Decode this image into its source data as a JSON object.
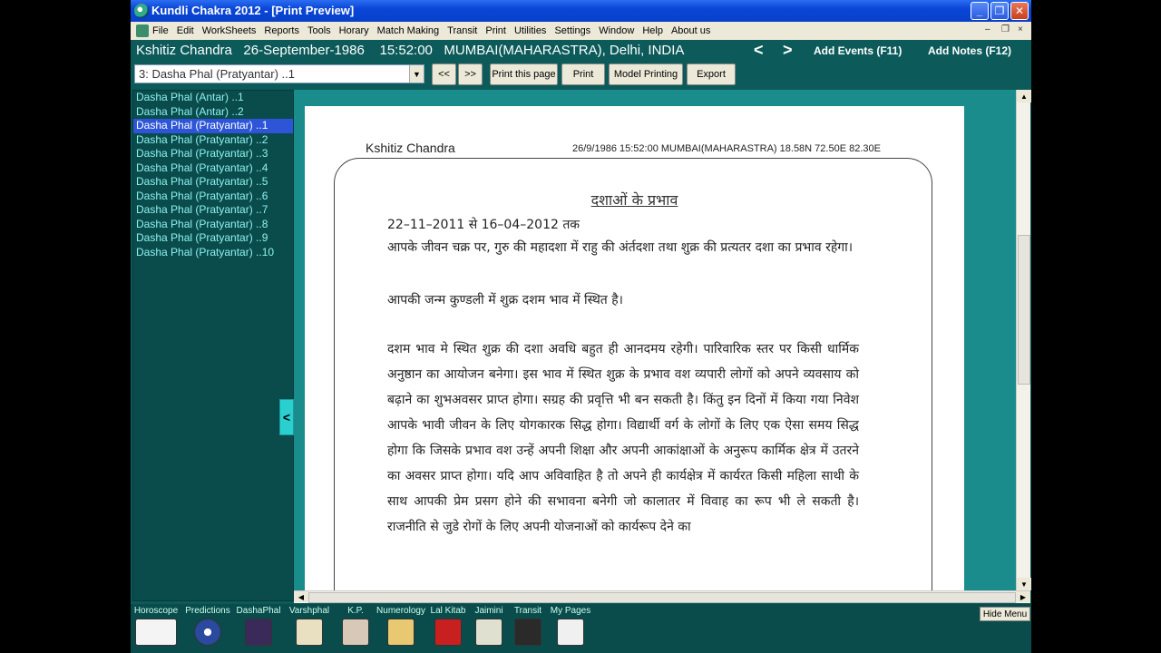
{
  "window": {
    "title": "Kundli Chakra 2012 - [Print Preview]",
    "min": "_",
    "max": "❐",
    "close": "✕"
  },
  "menu": [
    "File",
    "Edit",
    "WorkSheets",
    "Reports",
    "Tools",
    "Horary",
    "Match Making",
    "Transit",
    "Print",
    "Utilities",
    "Settings",
    "Window",
    "Help",
    "About us"
  ],
  "mdi": {
    "min": "–",
    "restore": "❐",
    "close": "×"
  },
  "info": {
    "name": "Kshitiz Chandra",
    "dob": "26-September-1986",
    "time": "15:52:00",
    "place": "MUMBAI(MAHARASTRA), Delhi, INDIA",
    "prev": "<",
    "next": ">",
    "add_events": "Add Events (F11)",
    "add_notes": "Add Notes (F12)"
  },
  "toolbar": {
    "selected": "3: Dasha Phal (Pratyantar) ..1",
    "prev_page": "<<",
    "next_page": ">>",
    "print_page": "Print this page",
    "print": "Print",
    "model_printing": "Model Printing",
    "export": "Export"
  },
  "sidebar": {
    "items": [
      "Dasha Phal (Antar) ..1",
      "Dasha Phal (Antar) ..2",
      "Dasha Phal (Pratyantar) ..1",
      "Dasha Phal (Pratyantar) ..2",
      "Dasha Phal (Pratyantar) ..3",
      "Dasha Phal (Pratyantar) ..4",
      "Dasha Phal (Pratyantar) ..5",
      "Dasha Phal (Pratyantar) ..6",
      "Dasha Phal (Pratyantar) ..7",
      "Dasha Phal (Pratyantar) ..8",
      "Dasha Phal (Pratyantar) ..9",
      "Dasha Phal (Pratyantar) ..10"
    ],
    "selected_index": 2,
    "collapse": "<"
  },
  "page": {
    "header_name": "Kshitiz Chandra",
    "header_info": "26/9/1986  15:52:00 MUMBAI(MAHARASTRA) 18.58N 72.50E 82.30E",
    "section_title": "दशाओं के प्रभाव",
    "date_range": "22–11–2011 से 16–04–2012 तक",
    "para1": "आपके जीवन चक्र पर, गुरु की महादशा में राहु की अंर्तदशा तथा शुक्र की प्रत्यतर दशा का प्रभाव रहेगा।",
    "para2": "आपकी जन्म कुण्डली में शुक्र दशम भाव में स्थित है।",
    "para3": "दशम भाव मे स्थित शुक्र की दशा अवधि बहुत ही आनदमय रहेगी। पारिवारिक स्तर पर किसी धार्मिक अनुष्ठान का आयोजन बनेगा। इस भाव में स्थित शुक्र के प्रभाव वश व्यपारी लोगों को अपने व्यवसाय को बढ़ाने का शुभअवसर प्राप्त होगा। सग्रह की प्रवृत्ति भी बन सकती है। किंतु इन दिनों में किया गया निवेश आपके भावी जीवन के लिए योगकारक सिद्ध होगा। विद्यार्थी वर्ग के लोगों के लिए एक ऐसा समय सिद्ध होगा कि जिसके प्रभाव वश उन्हें अपनी शिक्षा और अपनी आकांक्षाओं के अनुरूप कार्मिक क्षेत्र में उतरने का अवसर प्राप्त होगा। यदि आप अविवाहित है तो अपने ही कार्यक्षेत्र में कार्यरत किसी महिला साथी के साथ आपकी प्रेम प्रसग होने की सभावना बनेगी जो कालातर में विवाह का रूप भी ले सकती है। राजनीति से जुडे रोगों के लिए अपनी योजनाओं को कार्यरूप देने का"
  },
  "scroll": {
    "up": "▲",
    "down": "▼",
    "left": "◀",
    "right": "▶"
  },
  "bottom": {
    "items": [
      {
        "label": "Horoscope",
        "icon": "horoscope-chart-icon",
        "color": "#f4f4f4"
      },
      {
        "label": "Predictions",
        "icon": "zodiac-wheel-icon",
        "color": "#2a4aa0"
      },
      {
        "label": "DashaPhal",
        "icon": "dasha-figure-icon",
        "color": "#3a2a5a"
      },
      {
        "label": "Varshphal",
        "icon": "calendar-icon",
        "color": "#e8e0c0"
      },
      {
        "label": "K.P.",
        "icon": "person-icon",
        "color": "#d8c8b8"
      },
      {
        "label": "Numerology",
        "icon": "numerology-icon",
        "color": "#e8c870"
      },
      {
        "label": "Lal Kitab",
        "icon": "red-book-icon",
        "color": "#c82020"
      },
      {
        "label": "Jaimini",
        "icon": "jaimini-chart-icon",
        "color": "#e0e0d0"
      },
      {
        "label": "Transit",
        "icon": "planet-icon",
        "color": "#2a2a2a"
      },
      {
        "label": "My Pages",
        "icon": "pages-icon",
        "color": "#f0f0f0"
      }
    ],
    "hide_menu": "Hide Menu"
  }
}
